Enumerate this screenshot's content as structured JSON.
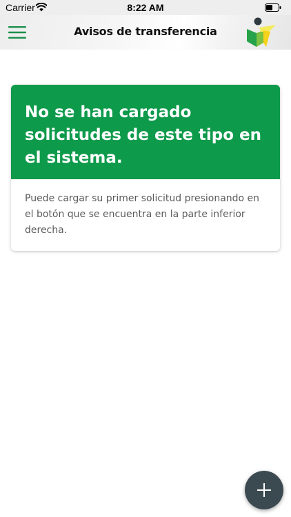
{
  "status_bar": {
    "carrier": "Carrier",
    "time": "8:22 AM"
  },
  "nav": {
    "title": "Avisos de transferencia",
    "menu_icon": "hamburger-menu-icon",
    "logo_icon": "app-logo-icon"
  },
  "empty_state": {
    "title": "No se han cargado solicitudes de este tipo en el sistema.",
    "message": "Puede cargar su primer solicitud presionando en el botón que se encuentra en la parte inferior derecha."
  },
  "fab": {
    "icon": "plus-icon"
  },
  "colors": {
    "accent_green": "#0e9a4b",
    "menu_icon": "#1a8f4c",
    "fab_bg": "#3b4a50"
  }
}
